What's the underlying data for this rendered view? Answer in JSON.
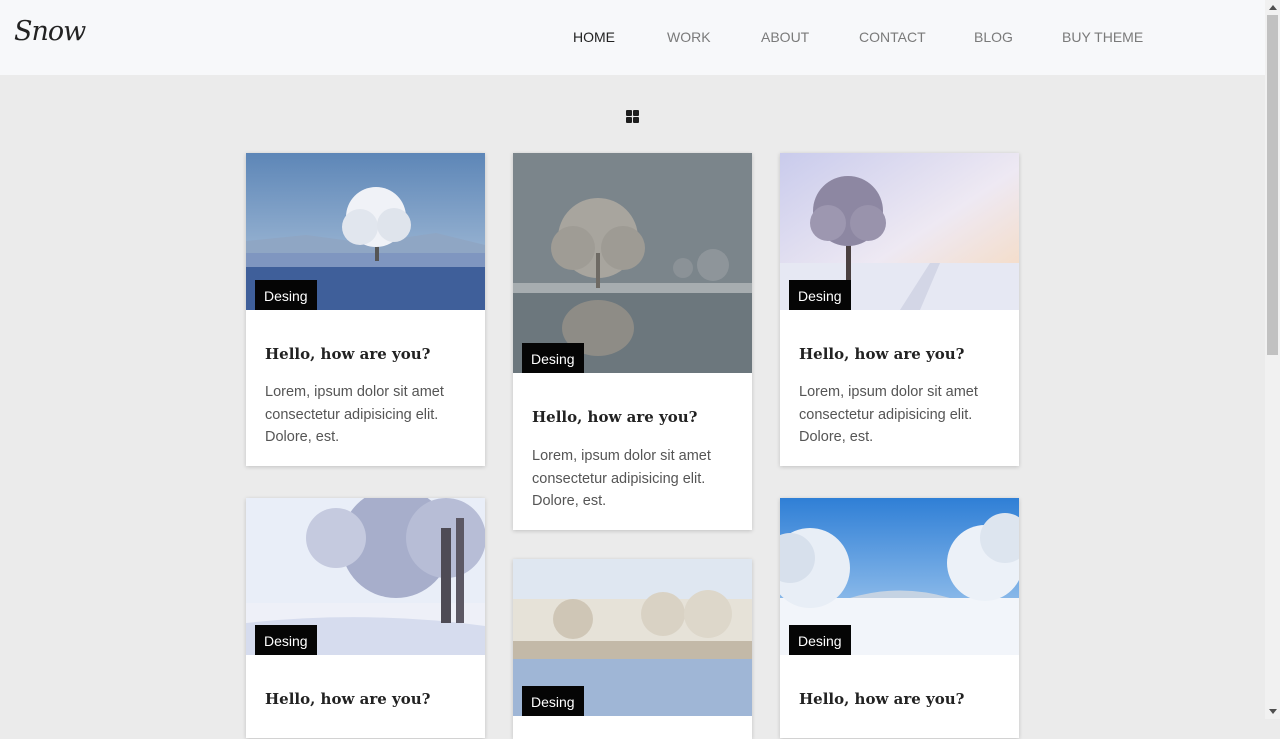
{
  "header": {
    "logo": "Snow",
    "nav": [
      {
        "label": "HOME",
        "active": true
      },
      {
        "label": "WORK",
        "active": false
      },
      {
        "label": "ABOUT",
        "active": false
      },
      {
        "label": "CONTACT",
        "active": false
      },
      {
        "label": "BLOG",
        "active": false
      },
      {
        "label": "BUY THEME",
        "active": false
      }
    ]
  },
  "layout_toggle": {
    "icon": "grid-icon"
  },
  "cards": [
    {
      "badge": "Desing",
      "title": "Hello, how are you?",
      "text": "Lorem, ipsum dolor sit amet consectetur adipisicing elit. Dolore, est."
    },
    {
      "badge": "Desing",
      "title": "Hello, how are you?",
      "text": "Lorem, ipsum dolor sit amet consectetur adipisicing elit. Dolore, est."
    },
    {
      "badge": "Desing",
      "title": "Hello, how are you?",
      "text": "Lorem, ipsum dolor sit amet consectetur adipisicing elit. Dolore, est."
    },
    {
      "badge": "Desing",
      "title": "Hello, how are you?",
      "text": ""
    },
    {
      "badge": "Desing",
      "title": "",
      "text": ""
    },
    {
      "badge": "Desing",
      "title": "Hello, how are you?",
      "text": ""
    }
  ],
  "colors": {
    "page_bg": "#ebebeb",
    "header_bg": "#f7f8fa",
    "badge_bg": "#050505",
    "nav_active": "#222222",
    "nav_inactive": "#7a7a7a"
  }
}
